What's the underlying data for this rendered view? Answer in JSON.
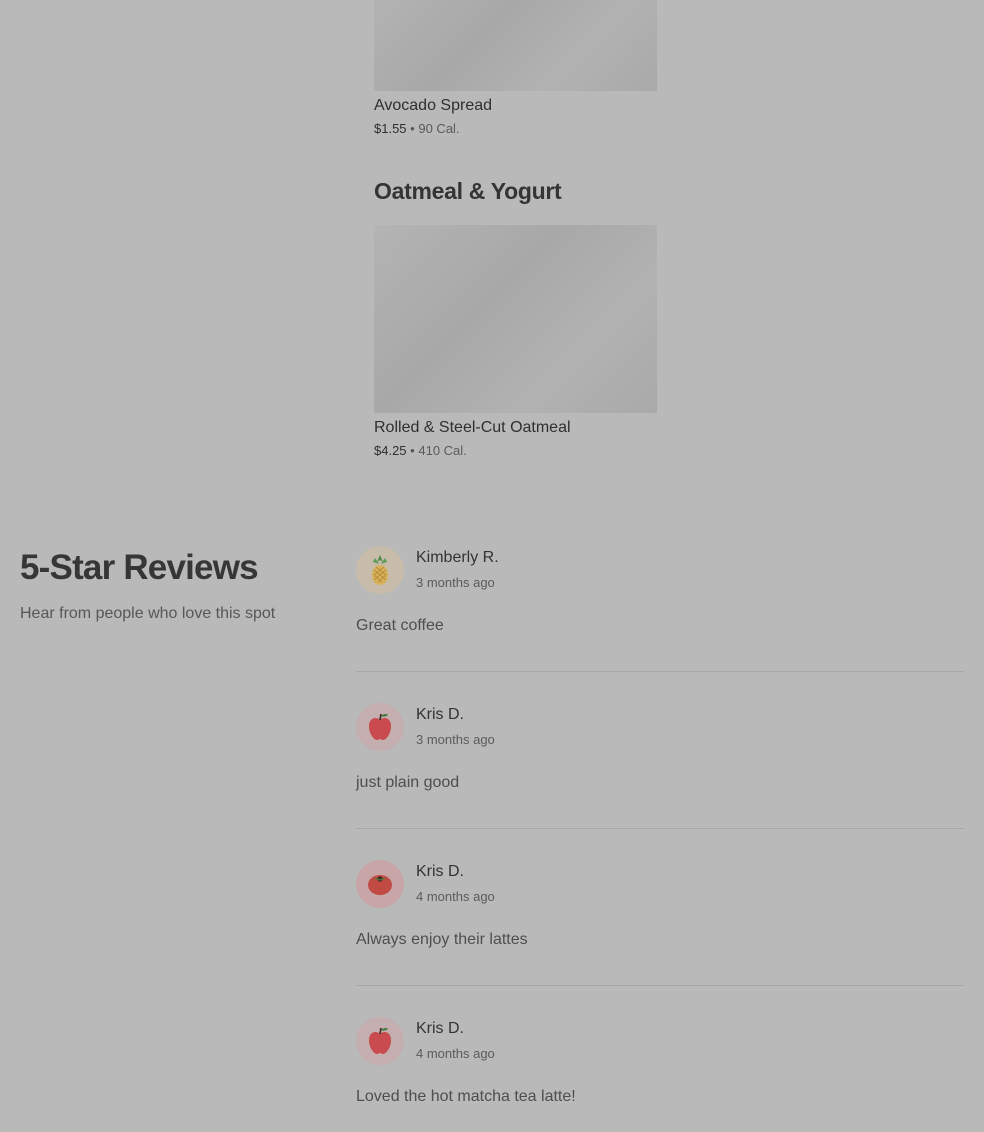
{
  "menu": {
    "items": [
      {
        "name": "Avocado Spread",
        "price": "$1.55",
        "separator": "•",
        "calories": "90 Cal."
      },
      {
        "name": "Rolled & Steel-Cut Oatmeal",
        "price": "$4.25",
        "separator": "•",
        "calories": "410 Cal."
      }
    ],
    "section_heading": "Oatmeal & Yogurt"
  },
  "reviews": {
    "title": "5-Star Reviews",
    "subtitle": "Hear from people who love this spot",
    "list": [
      {
        "name": "Kimberly R.",
        "date": "3 months ago",
        "text": "Great coffee",
        "avatar_icon": "pineapple-icon",
        "avatar_bg": "#c7bba9"
      },
      {
        "name": "Kris D.",
        "date": "3 months ago",
        "text": "just plain good",
        "avatar_icon": "apple-icon",
        "avatar_bg": "#c5aeb0"
      },
      {
        "name": "Kris D.",
        "date": "4 months ago",
        "text": "Always enjoy their lattes",
        "avatar_icon": "tomato-icon",
        "avatar_bg": "#c8a6a8"
      },
      {
        "name": "Kris D.",
        "date": "4 months ago",
        "text": "Loved the hot matcha tea latte!",
        "avatar_icon": "apple-icon",
        "avatar_bg": "#c5aeb0"
      }
    ]
  }
}
